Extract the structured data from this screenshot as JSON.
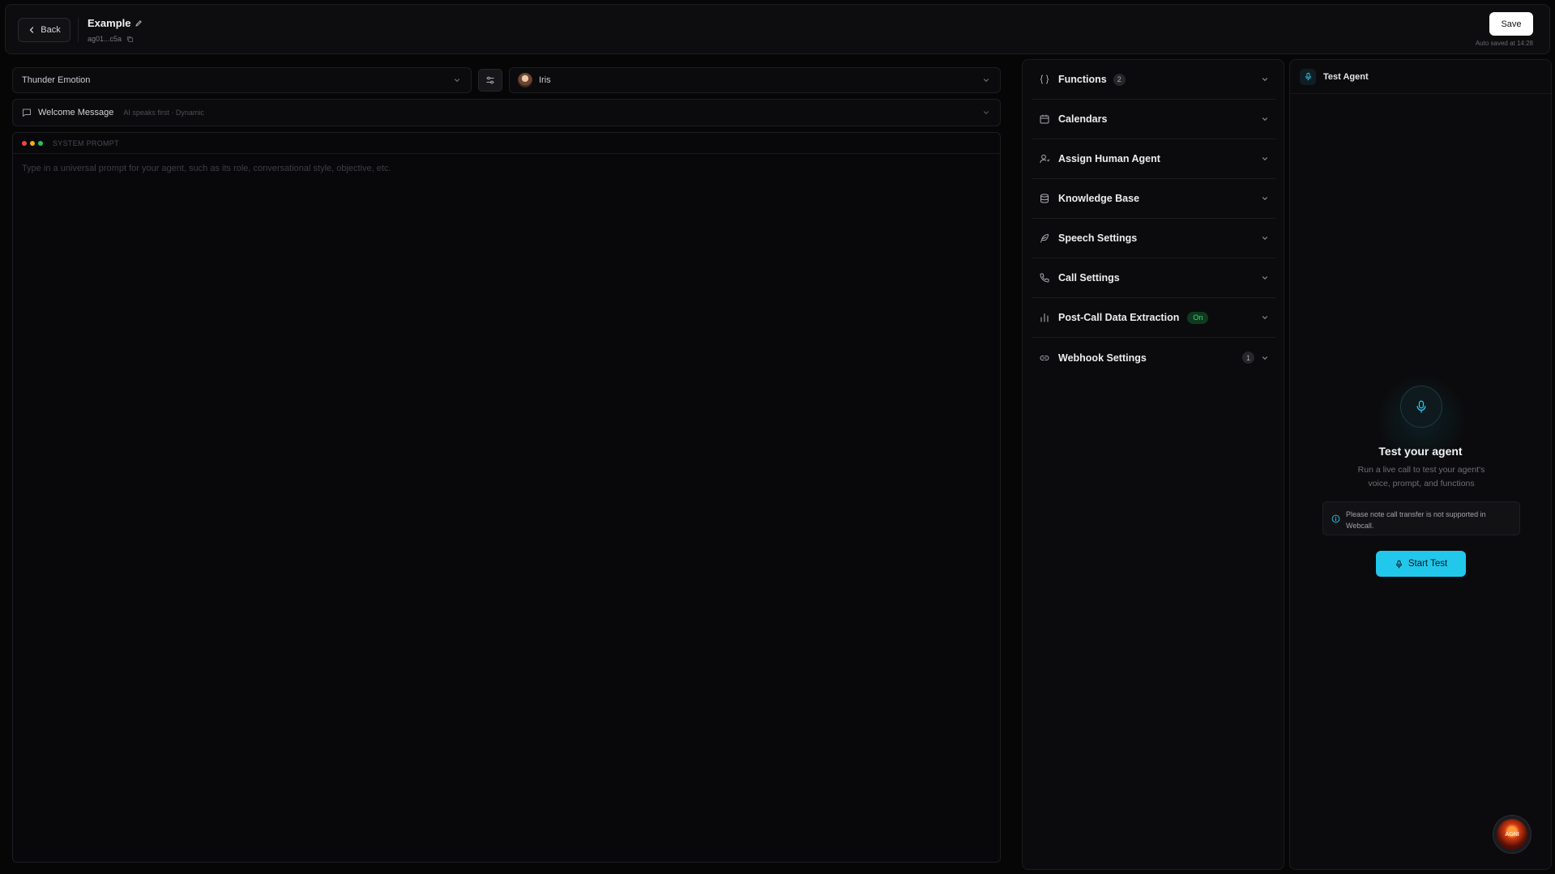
{
  "header": {
    "back_label": "Back",
    "title": "Example",
    "agent_id": "ag01...c5a",
    "save_label": "Save",
    "autosave_text": "Auto saved at 14:28"
  },
  "editor": {
    "model_select_value": "Thunder Emotion",
    "voice_select_value": "Iris",
    "welcome_label": "Welcome Message",
    "welcome_sub": "AI speaks first · Dynamic",
    "system_prompt_label": "SYSTEM PROMPT",
    "prompt_placeholder": "Type in a universal prompt for your agent, such as its role, conversational style, objective, etc.",
    "prompt_value": ""
  },
  "settings": {
    "items": [
      {
        "label": "Functions",
        "icon": "braces-icon",
        "count": "2"
      },
      {
        "label": "Calendars",
        "icon": "calendar-icon"
      },
      {
        "label": "Assign Human Agent",
        "icon": "user-icon"
      },
      {
        "label": "Knowledge Base",
        "icon": "database-icon"
      },
      {
        "label": "Speech Settings",
        "icon": "feather-icon"
      },
      {
        "label": "Call Settings",
        "icon": "phone-icon"
      },
      {
        "label": "Post-Call Data Extraction",
        "icon": "bar-chart-icon",
        "status": "On"
      },
      {
        "label": "Webhook Settings",
        "icon": "link-icon",
        "count": "1"
      }
    ]
  },
  "test_panel": {
    "header_label": "Test Agent",
    "title": "Test your agent",
    "description": "Run a live call to test your agent's voice, prompt, and functions",
    "notice": "Please note call transfer is not supported in Webcall.",
    "start_label": "Start Test",
    "fab_text": "AGNI"
  },
  "colors": {
    "background": "#060607",
    "panel": "#0b0b0d",
    "accent": "#22c8ec",
    "status_on": "#3ddc74",
    "dot_red": "#ef4444",
    "dot_yellow": "#eab308",
    "dot_green": "#22c55e"
  }
}
